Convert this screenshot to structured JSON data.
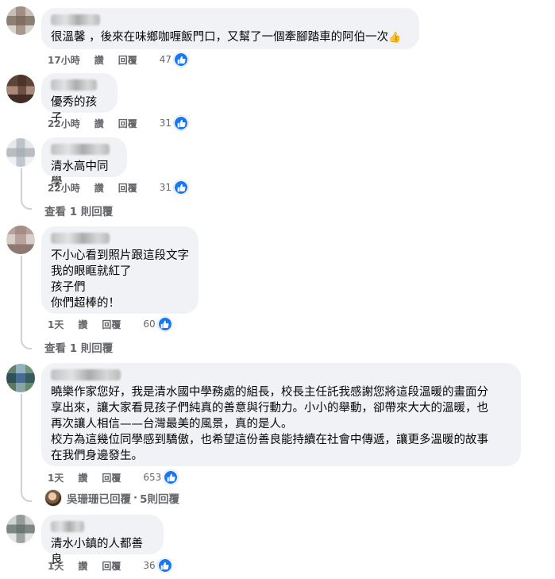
{
  "comments": [
    {
      "text": "很溫馨 ，後來在味鄉咖喱飯門口，又幫了一個牽腳踏車的阿伯一次",
      "emoji": "👍",
      "time": "17小時",
      "like": "讚",
      "reply": "回覆",
      "reactions": "47"
    },
    {
      "text": "優秀的孩子",
      "time": "22小時",
      "like": "讚",
      "reply": "回覆",
      "reactions": "31"
    },
    {
      "text": "清水高中同學",
      "time": "22小時",
      "like": "讚",
      "reply": "回覆",
      "reactions": "31",
      "view_replies": "查看 1 則回覆"
    },
    {
      "text": "不小心看到照片跟這段文字\n我的眼眶就紅了\n孩子們\n你們超棒的！",
      "time": "1天",
      "like": "讚",
      "reply": "回覆",
      "reactions": "60",
      "view_replies": "查看 1 則回覆"
    },
    {
      "text": "曉樂作家您好，我是清水國中學務處的組長，校長主任託我感謝您將這段溫暖的畫面分\n享出來，讓大家看見孩子們純真的善意與行動力。小小的舉動，卻帶來大大的溫暖，也\n再次讓人相信——台灣最美的風景，真的是人。\n校方為這幾位同學感到驕傲，也希望這份善良能持續在社會中傳遞，讓更多溫暖的故事\n在我們身邊發生。",
      "time": "1天",
      "like": "讚",
      "reply": "回覆",
      "reactions": "653",
      "replied_by": "吳珊珊已回覆",
      "replied_sep": "·",
      "replied_count": "5則回覆"
    },
    {
      "text": "清水小鎮的人都善良",
      "time": "1天",
      "like": "讚",
      "reply": "回覆",
      "reactions": "36"
    }
  ],
  "colors": {
    "bubble": "#f0f2f5",
    "meta": "#65676b",
    "like_blue": "#1877f2",
    "thread_line": "#ced0d4"
  },
  "icons": {
    "like": "thumbs-up-icon",
    "avatar": "pixelated-avatar"
  }
}
